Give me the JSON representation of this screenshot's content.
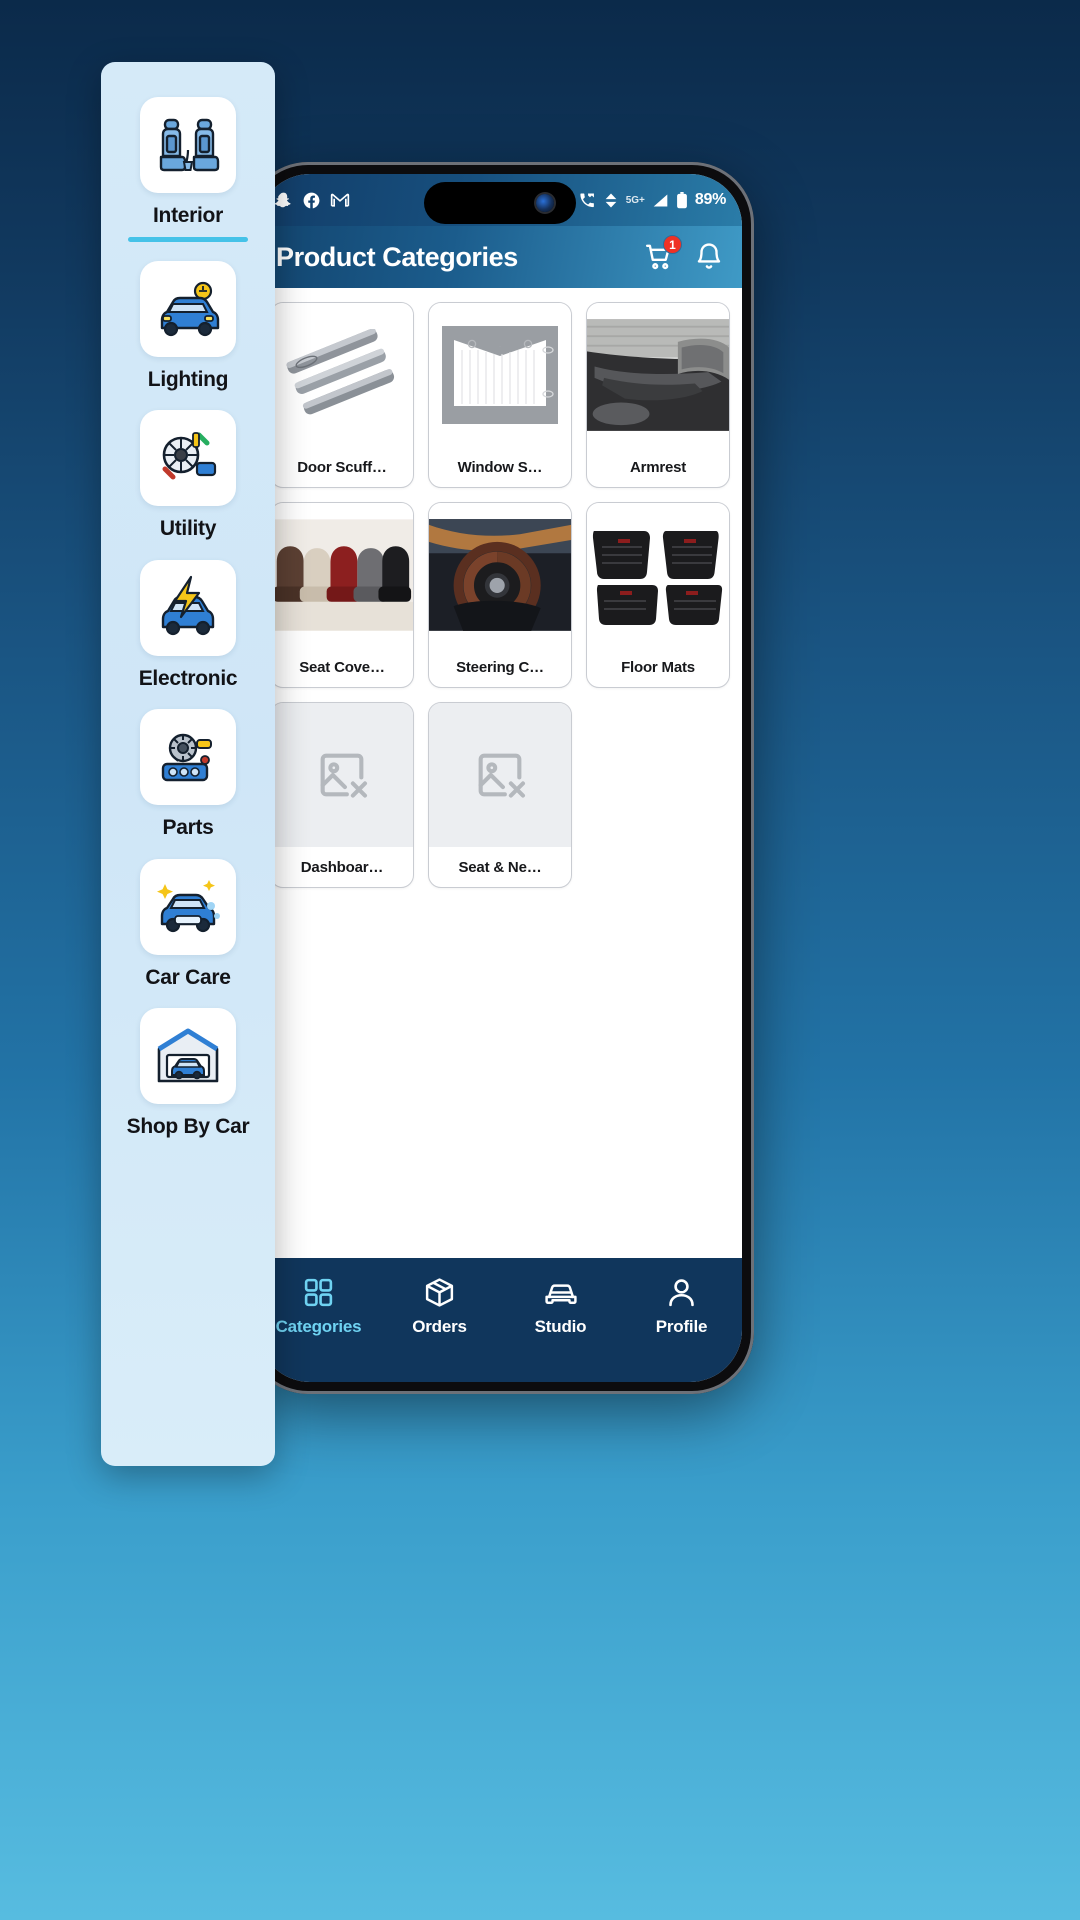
{
  "statusbar": {
    "left_icons": [
      "snapchat-icon",
      "facebook-icon",
      "gmail-icon"
    ],
    "right_icons": [
      "alarm-icon",
      "missed-call-icon",
      "data-transfer-icon",
      "signal-icon",
      "battery-icon"
    ],
    "network_label": "5G+",
    "battery_text": "89%"
  },
  "header": {
    "title": "Product Categories",
    "cart_badge": "1",
    "cart_icon": "shopping-cart-icon",
    "bell_icon": "notification-bell-icon"
  },
  "products": [
    {
      "label": "Door Scuff…",
      "icon": "door-scuff-plates-image",
      "placeholder": false
    },
    {
      "label": "Window S…",
      "icon": "window-sunshade-image",
      "placeholder": false
    },
    {
      "label": "Armrest",
      "icon": "armrest-image",
      "placeholder": false
    },
    {
      "label": "Seat Cove…",
      "icon": "seat-covers-image",
      "placeholder": false
    },
    {
      "label": "Steering C…",
      "icon": "steering-cover-image",
      "placeholder": false
    },
    {
      "label": "Floor Mats",
      "icon": "floor-mats-image",
      "placeholder": false
    },
    {
      "label": "Dashboar…",
      "icon": "broken-image-icon",
      "placeholder": true
    },
    {
      "label": "Seat & Ne…",
      "icon": "broken-image-icon",
      "placeholder": true
    }
  ],
  "bottomnav": {
    "items": [
      {
        "label": "Categories",
        "icon": "grid-squares-icon",
        "active": true
      },
      {
        "label": "Orders",
        "icon": "package-box-icon",
        "active": false
      },
      {
        "label": "Studio",
        "icon": "car-front-icon",
        "active": false
      },
      {
        "label": "Profile",
        "icon": "person-icon",
        "active": false
      }
    ]
  },
  "sidebar": {
    "items": [
      {
        "label": "Interior",
        "icon": "car-seats-icon",
        "selected": true
      },
      {
        "label": "Lighting",
        "icon": "car-headlight-icon",
        "selected": false
      },
      {
        "label": "Utility",
        "icon": "tools-wheel-icon",
        "selected": false
      },
      {
        "label": "Electronic",
        "icon": "car-electric-bolt-icon",
        "selected": false
      },
      {
        "label": "Parts",
        "icon": "engine-parts-icon",
        "selected": false
      },
      {
        "label": "Car Care",
        "icon": "car-wash-icon",
        "selected": false
      },
      {
        "label": "Shop By Car",
        "icon": "garage-car-icon",
        "selected": false
      }
    ]
  },
  "colors": {
    "accent": "#45c2e8",
    "header_blue": "#17507f",
    "nav_blue": "#10365c",
    "badge_red": "#ef3124",
    "sidebar_bg": "#d5eaf8"
  }
}
